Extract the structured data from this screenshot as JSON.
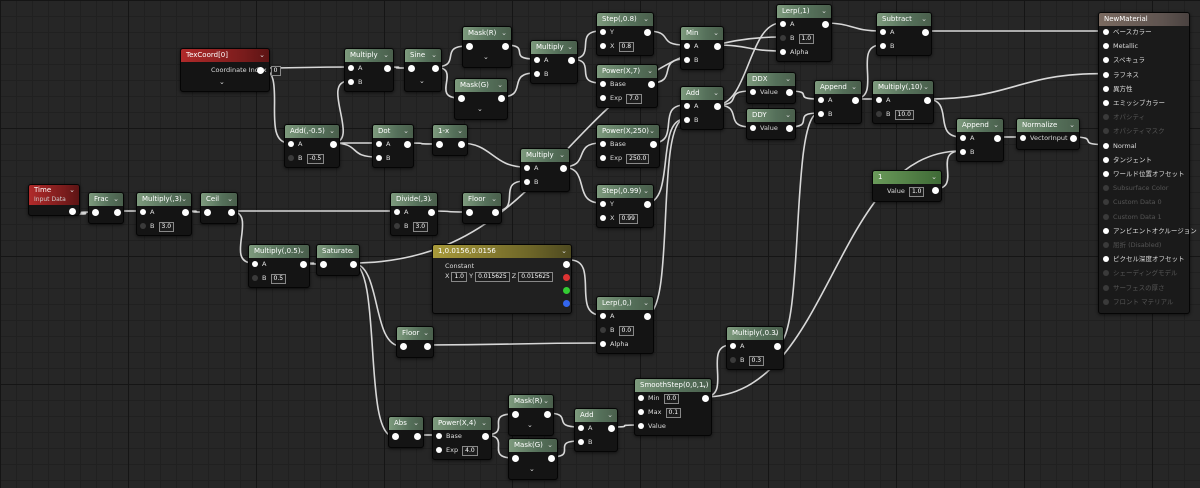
{
  "nodes": {
    "texcoord": {
      "title": "TexCoord[0]",
      "param_label": "Coordinate Index",
      "param_value": "0"
    },
    "time": {
      "title": "Time",
      "subtitle": "Input Data"
    },
    "frac": {
      "title": "Frac"
    },
    "multiply3": {
      "title": "Multiply(,3)",
      "b_value": "3.0"
    },
    "ceil": {
      "title": "Ceil"
    },
    "multiply05": {
      "title": "Multiply(,0.5)",
      "b_value": "0.5"
    },
    "saturate": {
      "title": "Saturate"
    },
    "add05": {
      "title": "Add(,-0.5)",
      "b_value": "-0.5"
    },
    "multiply_a": {
      "title": "Multiply"
    },
    "sine": {
      "title": "Sine"
    },
    "mask_r1": {
      "title": "Mask(R)"
    },
    "mask_g1": {
      "title": "Mask(G)"
    },
    "multiply_b": {
      "title": "Multiply"
    },
    "step08": {
      "title": "Step(,0.8)",
      "x_value": "0.8"
    },
    "power7": {
      "title": "Power(X,7)",
      "exp_value": "7.0"
    },
    "min": {
      "title": "Min"
    },
    "add_c": {
      "title": "Add"
    },
    "lerp1": {
      "title": "Lerp(,1)",
      "b_value": "1.0"
    },
    "ddx": {
      "title": "DDX"
    },
    "ddy": {
      "title": "DDY"
    },
    "append1": {
      "title": "Append"
    },
    "subtract": {
      "title": "Subtract"
    },
    "multiply10": {
      "title": "Multiply(,10)",
      "b_value": "10.0"
    },
    "dot": {
      "title": "Dot"
    },
    "onex": {
      "title": "1-x"
    },
    "multiply_c": {
      "title": "Multiply"
    },
    "power250": {
      "title": "Power(X,250)",
      "exp_value": "250.0"
    },
    "step099": {
      "title": "Step(,0.99)",
      "x_value": "0.99"
    },
    "divide3": {
      "title": "Divide(,3)",
      "b_value": "3.0"
    },
    "floor1": {
      "title": "Floor"
    },
    "append2": {
      "title": "Append"
    },
    "normalize": {
      "title": "Normalize",
      "pin": "VectorInput"
    },
    "const1": {
      "title": "1",
      "pin_label": "Value",
      "pin_value": "1.0"
    },
    "const3": {
      "title": "1,0.0156,0.0156",
      "sub": "Constant",
      "x": "1.0",
      "y": "0.015625",
      "z": "0.015625"
    },
    "lerp0": {
      "title": "Lerp(,0,)",
      "b_value": "0.0"
    },
    "floor2": {
      "title": "Floor"
    },
    "multiply03": {
      "title": "Multiply(,0.3)",
      "b_value": "0.3"
    },
    "smoothstep": {
      "title": "SmoothStep(0,0,1,)",
      "min_value": "0.0",
      "max_value": "0.1"
    },
    "abs": {
      "title": "Abs"
    },
    "power4": {
      "title": "Power(X,4)",
      "exp_value": "4.0"
    },
    "mask_r2": {
      "title": "Mask(R)"
    },
    "mask_g2": {
      "title": "Mask(G)"
    },
    "add_d": {
      "title": "Add"
    }
  },
  "labels": {
    "a": "A",
    "b": "B",
    "alpha": "Alpha",
    "x": "X",
    "y": "Y",
    "base": "Base",
    "exp": "Exp",
    "value": "Value",
    "min": "Min",
    "max": "Max",
    "xl": "X",
    "yl": "Y",
    "zl": "Z"
  },
  "material": {
    "title": "NewMaterial",
    "pins": [
      {
        "label": "ベースカラー",
        "active": true
      },
      {
        "label": "Metallic",
        "active": true
      },
      {
        "label": "スペキュラ",
        "active": true
      },
      {
        "label": "ラフネス",
        "active": true
      },
      {
        "label": "異方性",
        "active": true
      },
      {
        "label": "エミッシブカラー",
        "active": true
      },
      {
        "label": "オパシティ",
        "active": false
      },
      {
        "label": "オパシティマスク",
        "active": false
      },
      {
        "label": "Normal",
        "active": true
      },
      {
        "label": "タンジェント",
        "active": true
      },
      {
        "label": "ワールド位置オフセット",
        "active": true
      },
      {
        "label": "Subsurface Color",
        "active": false
      },
      {
        "label": "Custom Data 0",
        "active": false
      },
      {
        "label": "Custom Data 1",
        "active": false
      },
      {
        "label": "アンビエントオクルージョン",
        "active": true
      },
      {
        "label": "屈折 (Disabled)",
        "active": false
      },
      {
        "label": "ピクセル深度オフセット",
        "active": true
      },
      {
        "label": "シェーディングモデル",
        "active": false
      },
      {
        "label": "サーフェスの厚さ",
        "active": false
      },
      {
        "label": "フロント マテリアル",
        "active": false
      }
    ]
  },
  "colors": {
    "wire": "#d8d8d8",
    "node_bg": "#141414",
    "header_green": "#5f7a62",
    "header_red": "#8a2020",
    "header_yellow": "#8a7f30"
  }
}
